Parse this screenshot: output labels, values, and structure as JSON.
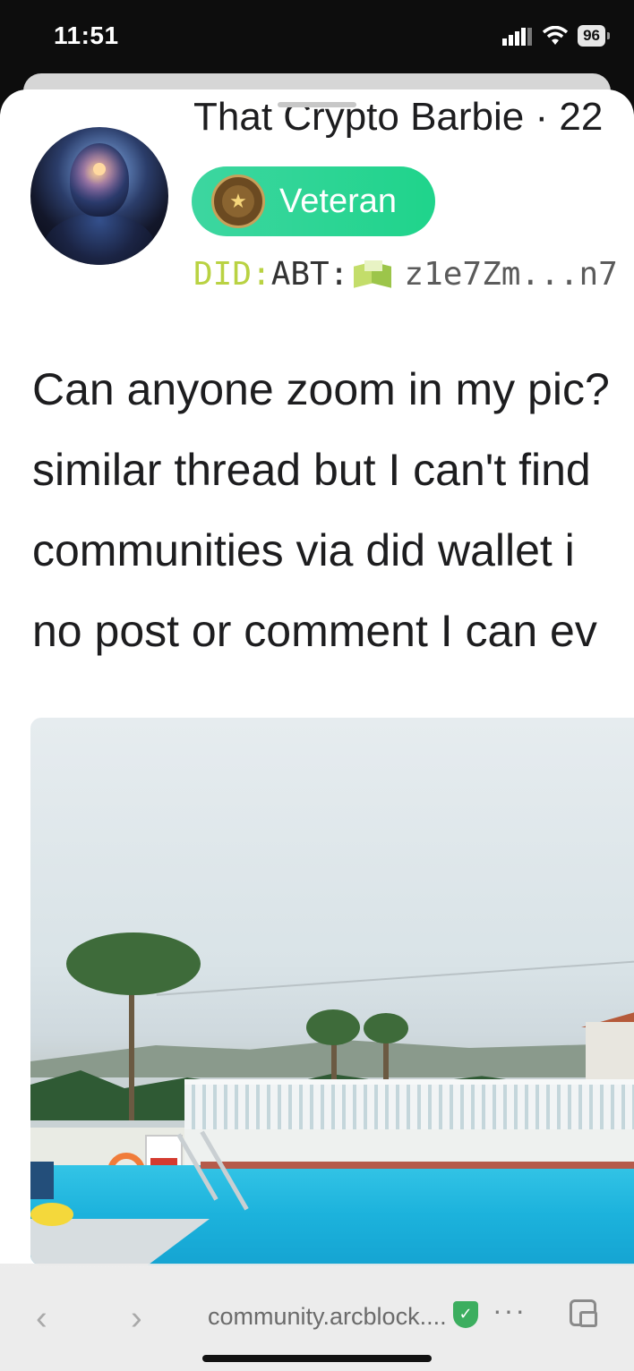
{
  "status_bar": {
    "time": "11:51",
    "battery": "96",
    "icons": [
      "signal-icon",
      "wifi-icon",
      "battery-icon"
    ]
  },
  "post": {
    "author_name": "That Crypto Barbie · 22",
    "badge_label": "Veteran",
    "did_prefix": "DID:",
    "did_abt": "ABT:",
    "did_address": "z1e7Zm...n7",
    "body_lines": [
      "Can anyone zoom in my pic?",
      "similar thread but I can't find",
      "communities via did wallet i",
      "no post or comment I can ev"
    ]
  },
  "browser": {
    "url": "community.arcblock....",
    "more_label": "···",
    "back_label": "‹",
    "forward_label": "›"
  },
  "colors": {
    "badge_green": "#22d68f",
    "did_prefix": "#b9d242",
    "secure_shield": "#3cae5f"
  }
}
